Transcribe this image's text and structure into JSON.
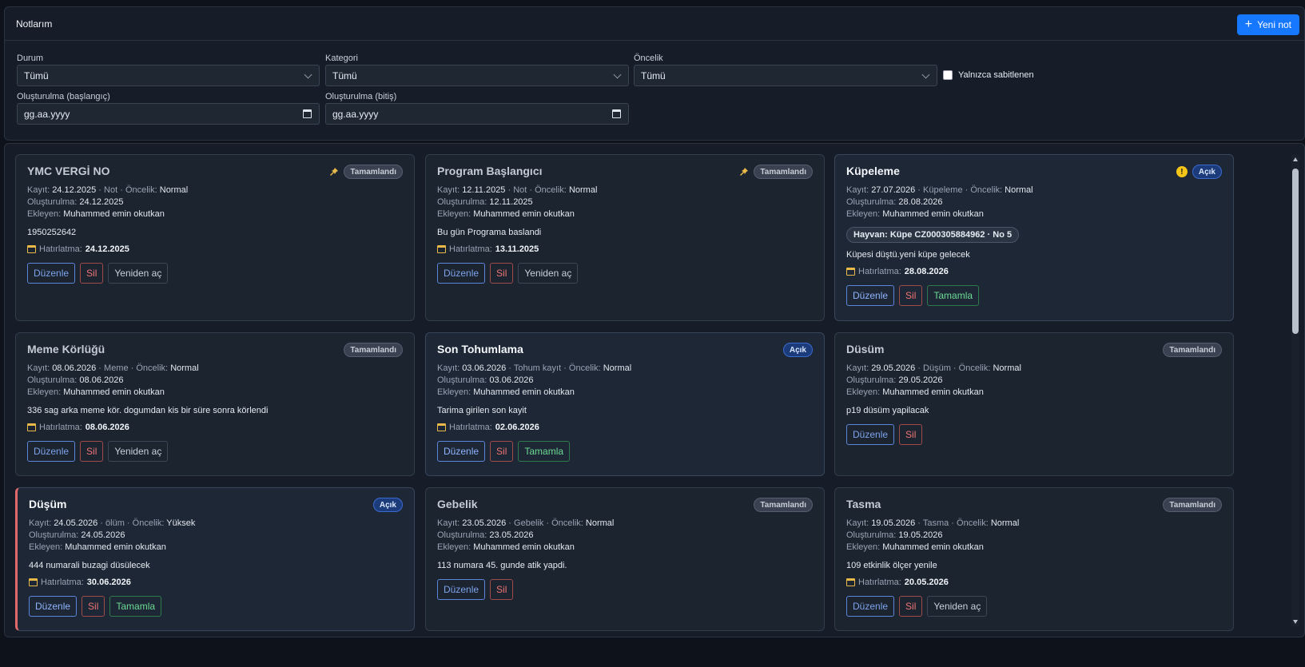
{
  "header": {
    "title": "Notlarım",
    "new_button": "Yeni not"
  },
  "filters": {
    "status": {
      "label": "Durum",
      "value": "Tümü"
    },
    "category": {
      "label": "Kategori",
      "value": "Tümü"
    },
    "priority": {
      "label": "Öncelik",
      "value": "Tümü"
    },
    "pinned_only": {
      "label": "Yalnızca sabitlenen",
      "checked": false
    },
    "created_from": {
      "label": "Oluşturulma (başlangıç)",
      "value": "gg.aa.yyyy"
    },
    "created_to": {
      "label": "Oluşturulma (bitiş)",
      "value": "gg.aa.yyyy"
    }
  },
  "labels": {
    "kayit": "Kayıt:",
    "oncelik": "Öncelik:",
    "olusturulma": "Oluşturulma:",
    "ekleyen": "Ekleyen:",
    "hatirlatma": "Hatırlatma:",
    "edit": "Düzenle",
    "delete": "Sil",
    "reopen": "Yeniden aç",
    "complete": "Tamamla"
  },
  "notes": [
    {
      "title": "YMC VERGİ NO",
      "status": "Tamamlandı",
      "pinned": true,
      "kayit": "24.12.2025",
      "category": "Not",
      "priority": "Normal",
      "created": "24.12.2025",
      "author": "Muhammed emin okutkan",
      "body": "1950252642",
      "reminder": "24.12.2025"
    },
    {
      "title": "Program Başlangıcı",
      "status": "Tamamlandı",
      "pinned": true,
      "kayit": "12.11.2025",
      "category": "Not",
      "priority": "Normal",
      "created": "12.11.2025",
      "author": "Muhammed emin okutkan",
      "body": "Bu gün Programa baslandi",
      "reminder": "13.11.2025"
    },
    {
      "title": "Küpeleme",
      "status": "Açık",
      "warning": "!",
      "kayit": "27.07.2026",
      "category": "Küpeleme",
      "priority": "Normal",
      "created": "28.08.2026",
      "author": "Muhammed emin okutkan",
      "animal": "Hayvan: Küpe CZ000305884962 · No 5",
      "body": "Küpesi düştü.yeni küpe gelecek",
      "reminder": "28.08.2026"
    },
    {
      "title": "Meme Körlüğü",
      "status": "Tamamlandı",
      "kayit": "08.06.2026",
      "category": "Meme",
      "priority": "Normal",
      "created": "08.06.2026",
      "author": "Muhammed emin okutkan",
      "body": "336 sag arka meme kör. dogumdan kis bir süre sonra körlendi",
      "reminder": "08.06.2026"
    },
    {
      "title": "Son Tohumlama",
      "status": "Açık",
      "kayit": "03.06.2026",
      "category": "Tohum kayıt",
      "priority": "Normal",
      "created": "03.06.2026",
      "author": "Muhammed emin okutkan",
      "body": "Tarima girilen son kayit",
      "reminder": "02.06.2026"
    },
    {
      "title": "Düsüm",
      "status": "Tamamlandı",
      "kayit": "29.05.2026",
      "category": "Düşüm",
      "priority": "Normal",
      "created": "29.05.2026",
      "author": "Muhammed emin okutkan",
      "body": "p19 düsüm yapilacak"
    },
    {
      "title": "Düşüm",
      "status": "Açık",
      "kayit": "24.05.2026",
      "category": "ölüm",
      "priority": "Yüksek",
      "created": "24.05.2026",
      "author": "Muhammed emin okutkan",
      "body": "444 numarali buzagi düsülecek",
      "reminder": "30.06.2026"
    },
    {
      "title": "Gebelik",
      "status": "Tamamlandı",
      "kayit": "23.05.2026",
      "category": "Gebelik",
      "priority": "Normal",
      "created": "23.05.2026",
      "author": "Muhammed emin okutkan",
      "body": "113 numara 45. gunde atik yapdi."
    },
    {
      "title": "Tasma",
      "status": "Tamamlandı",
      "kayit": "19.05.2026",
      "category": "Tasma",
      "priority": "Normal",
      "created": "19.05.2026",
      "author": "Muhammed emin okutkan",
      "body": "109 etkinlik ölçer yenile",
      "reminder": "20.05.2026"
    }
  ]
}
